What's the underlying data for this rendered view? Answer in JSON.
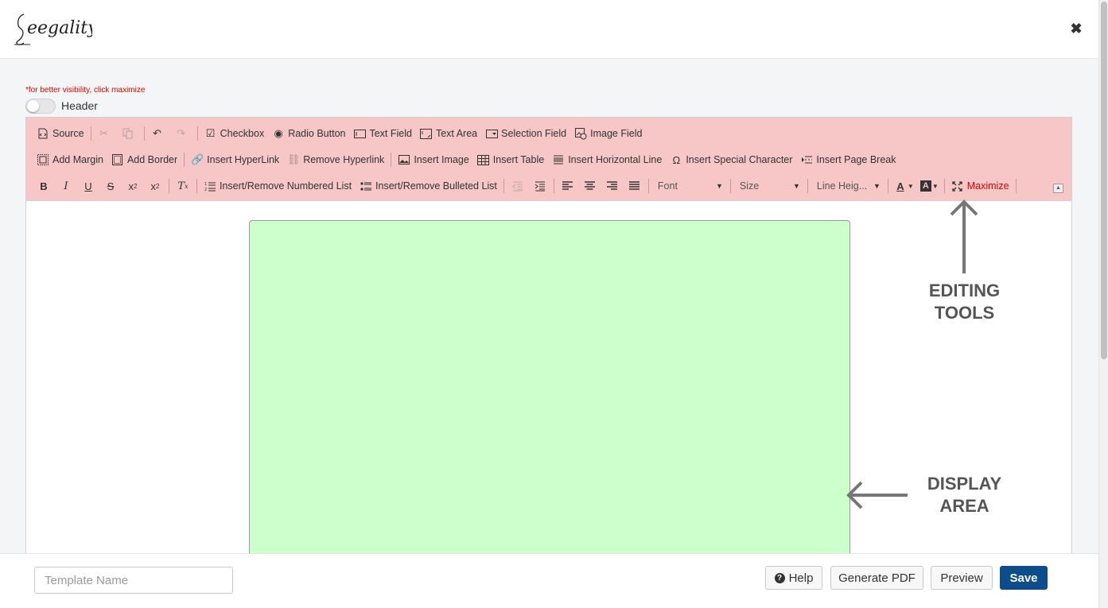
{
  "header": {
    "logo_text": "Leegality",
    "close_icon": "close-icon"
  },
  "visibility_hint": "*for better visibility, click maximize",
  "header_toggle": {
    "label": "Header",
    "on": false
  },
  "toolbar": {
    "row1": {
      "source": "Source",
      "checkbox": "Checkbox",
      "radio_button": "Radio Button",
      "text_field": "Text Field",
      "text_area": "Text Area",
      "selection_field": "Selection Field",
      "image_field": "Image Field"
    },
    "row2": {
      "add_margin": "Add Margin",
      "add_border": "Add Border",
      "insert_hyperlink": "Insert HyperLink",
      "remove_hyperlink": "Remove Hyperlink",
      "insert_image": "Insert Image",
      "insert_table": "Insert Table",
      "insert_horizontal_line": "Insert Horizontal Line",
      "insert_special_character": "Insert Special Character",
      "insert_page_break": "Insert Page Break"
    },
    "row3": {
      "numbered_list": "Insert/Remove Numbered List",
      "bulleted_list": "Insert/Remove Bulleted List",
      "font": "Font",
      "size": "Size",
      "line_height": "Line Heig...",
      "maximize": "Maximize"
    },
    "accent_color": "#f7c6c6",
    "maximize_color": "#e00000"
  },
  "annotations": {
    "editing_tools": [
      "EDITING",
      "TOOLS"
    ],
    "display_area": [
      "DISPLAY",
      "AREA"
    ]
  },
  "display_area_color": "#ccffcc",
  "footer": {
    "template_name_placeholder": "Template Name",
    "template_name_value": "",
    "help": "Help",
    "generate_pdf": "Generate PDF",
    "preview": "Preview",
    "save": "Save",
    "save_color": "#0d4d8c"
  }
}
